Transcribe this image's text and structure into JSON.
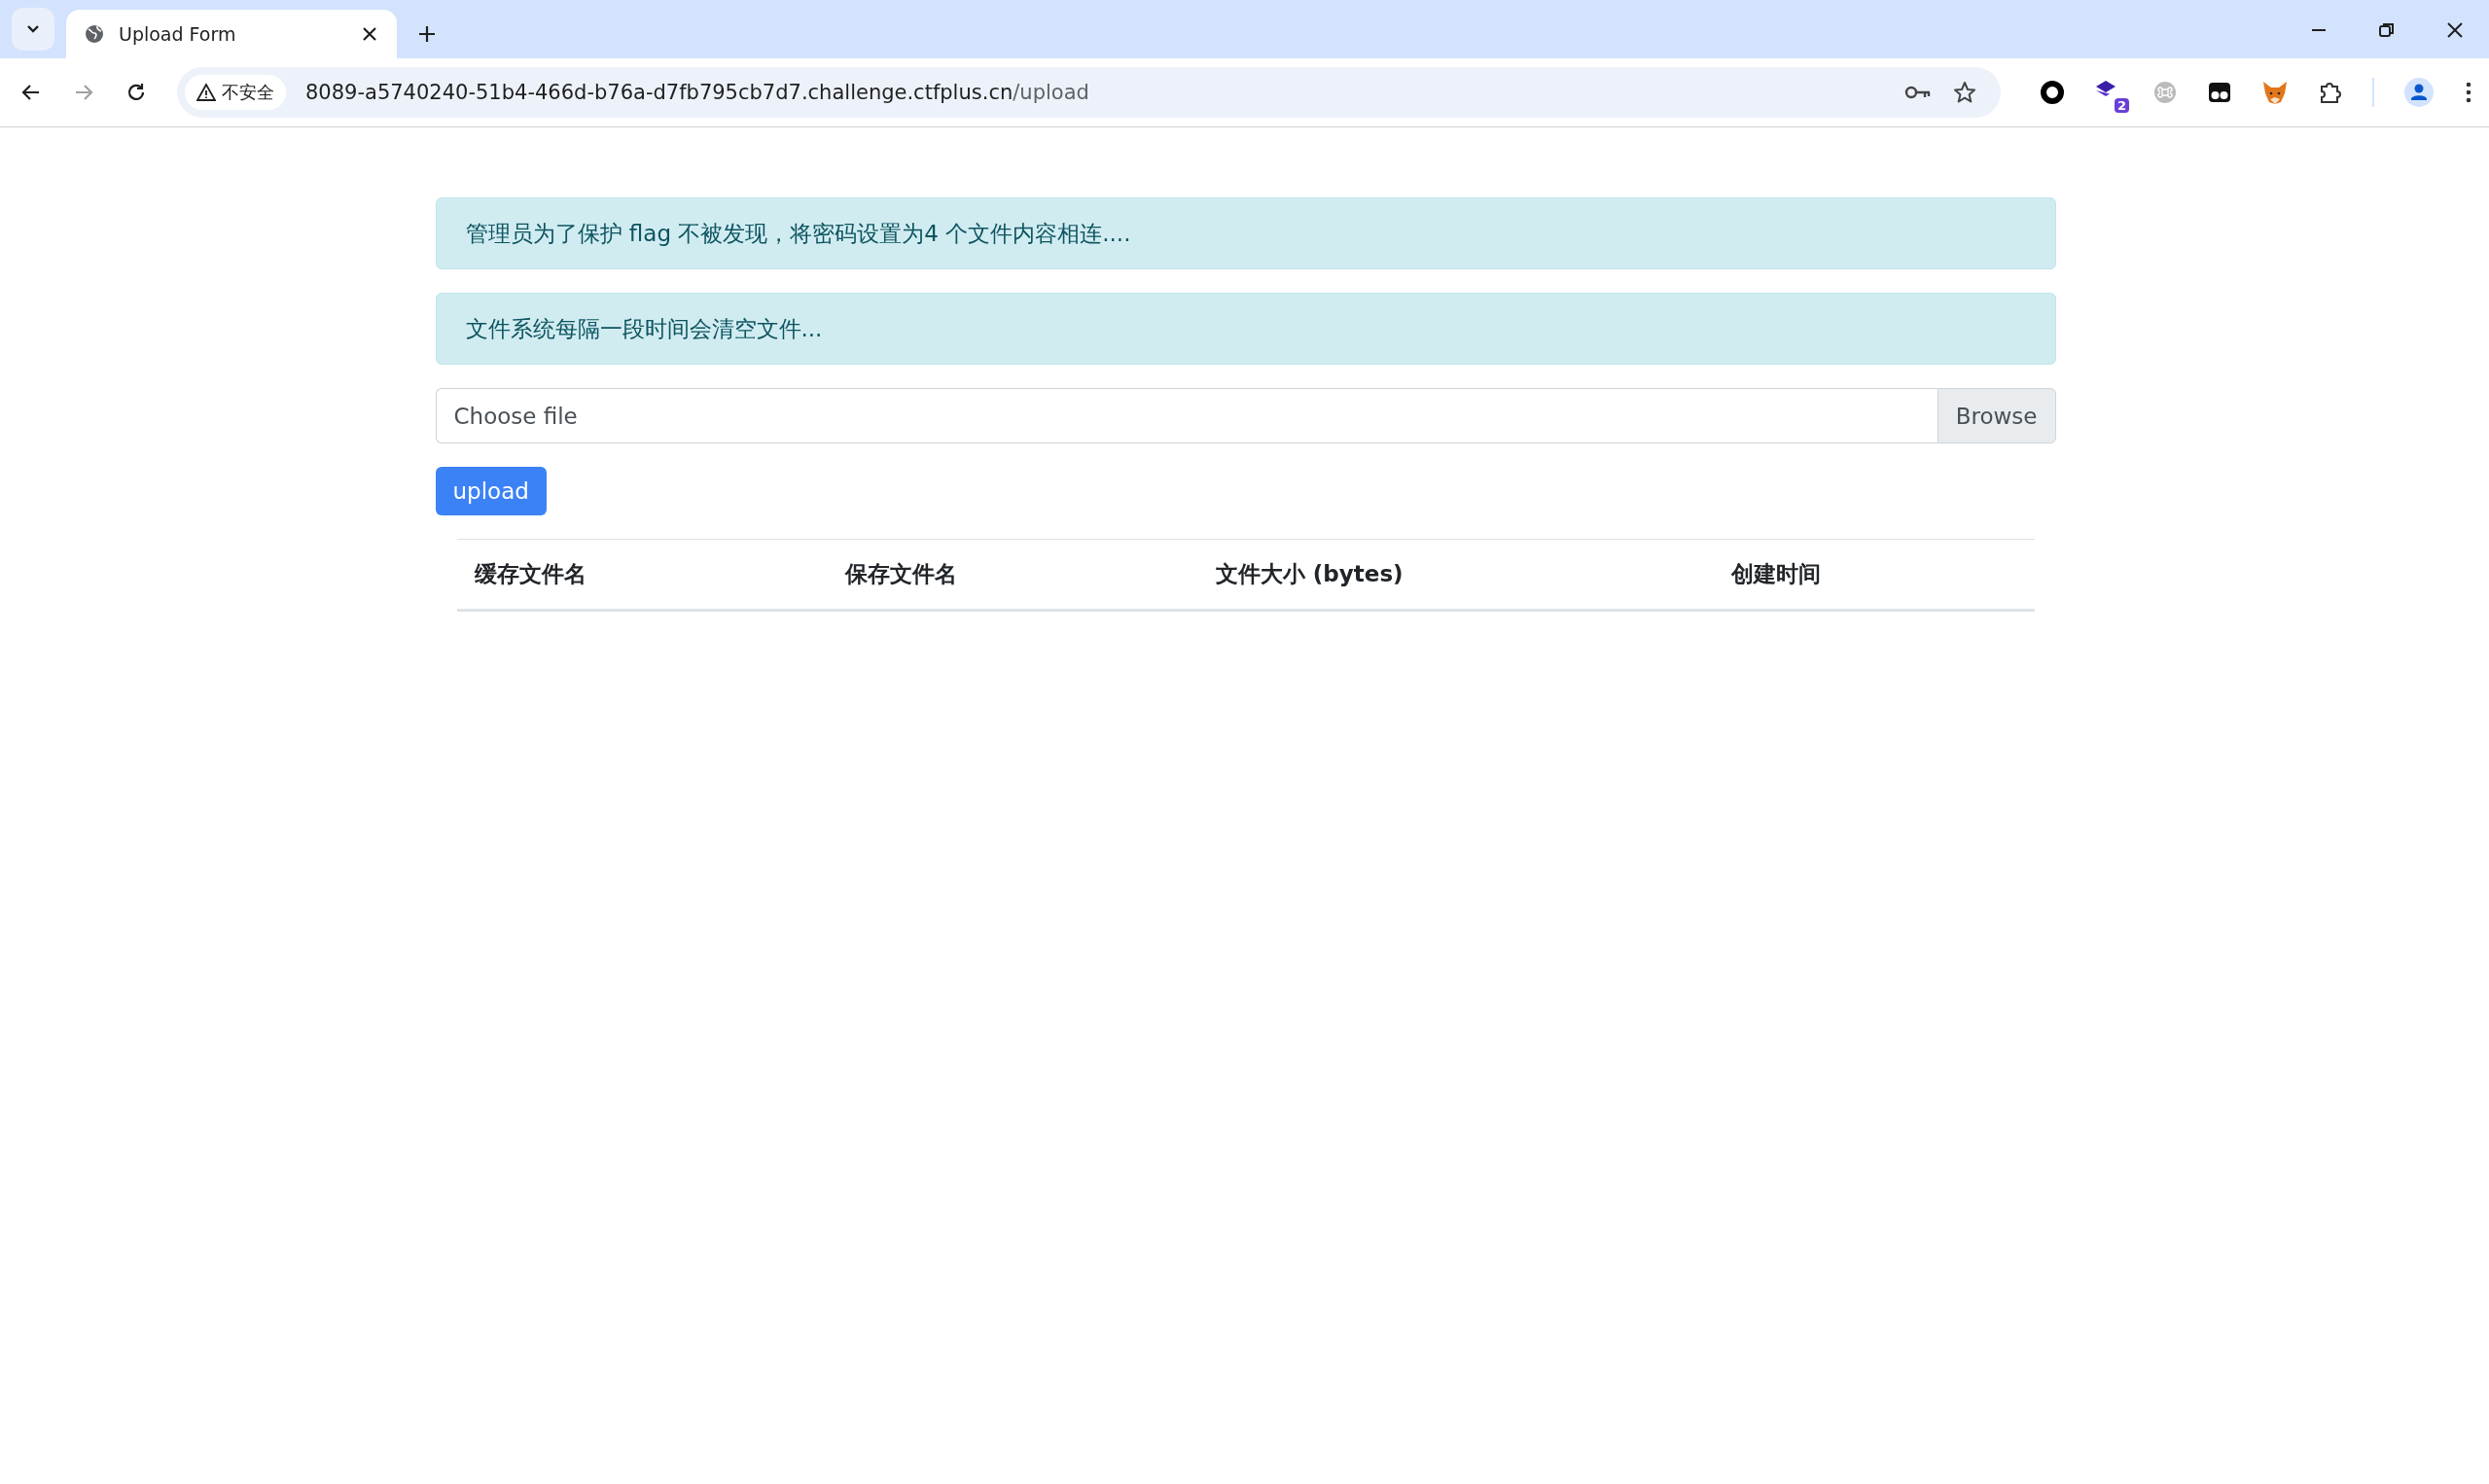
{
  "browser": {
    "tab": {
      "title": "Upload Form",
      "selected": true
    },
    "security_chip": "不安全",
    "url_host": "8089-a5740240-51b4-466d-b76a-d7fb795cb7d7.challenge.ctfplus.cn",
    "url_path": "/upload",
    "extension_badge": "2"
  },
  "alerts": [
    "管理员为了保护 flag 不被发现，将密码设置为4 个文件内容相连....",
    "文件系统每隔一段时间会清空文件..."
  ],
  "file_input": {
    "placeholder": "Choose file",
    "button": "Browse"
  },
  "upload_button": "upload",
  "table": {
    "columns": [
      "缓存文件名",
      "保存文件名",
      "文件大小 (bytes)",
      "创建时间"
    ]
  }
}
